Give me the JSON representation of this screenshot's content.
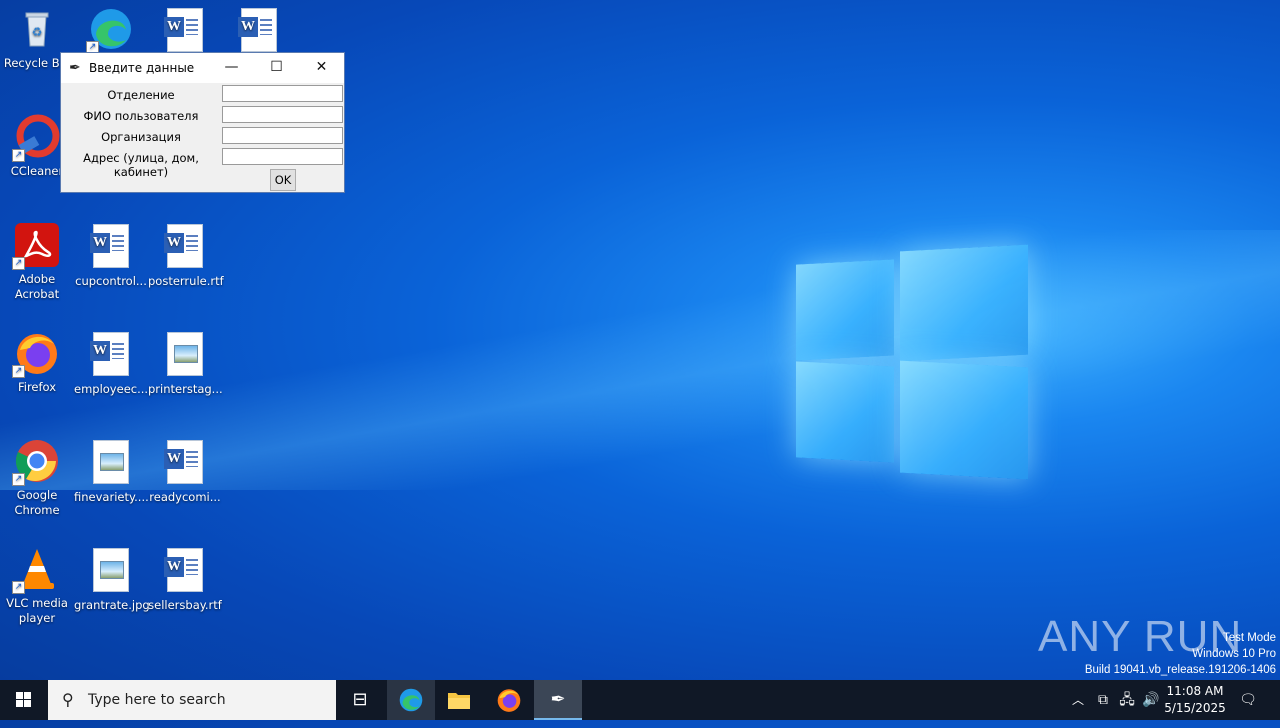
{
  "desktop": {
    "icons": {
      "recycle_bin": "Recycle Bin",
      "ccleaner": "CCleaner",
      "adobe_acrobat": "Adobe Acrobat",
      "cupcontrol": "cupcontrol...",
      "posterrule": "posterrule.rtf",
      "firefox": "Firefox",
      "employeec": "employeec...",
      "printerstag": "printerstag...",
      "google_chrome": "Google Chrome",
      "finevariety": "finevariety....",
      "readycomi": "readycomi...",
      "vlc": "VLC media player",
      "grantrate": "grantrate.jpg",
      "sellersbay": "sellersbay.rtf"
    }
  },
  "dialog": {
    "title": "Введите данные",
    "fields": [
      {
        "label": "Отделение",
        "value": ""
      },
      {
        "label": "ФИО пользователя",
        "value": ""
      },
      {
        "label": "Организация",
        "value": ""
      },
      {
        "label": "Адрес (улица, дом, кабинет)",
        "value": ""
      }
    ],
    "ok_label": "OK"
  },
  "watermark": {
    "brand": "ANY RUN",
    "line1": "Test Mode",
    "line2": "Windows 10 Pro",
    "line3": "Build 19041.vb_release.191206-1406"
  },
  "taskbar": {
    "search_placeholder": "Type here to search",
    "time": "11:08 AM",
    "date": "5/15/2025"
  }
}
